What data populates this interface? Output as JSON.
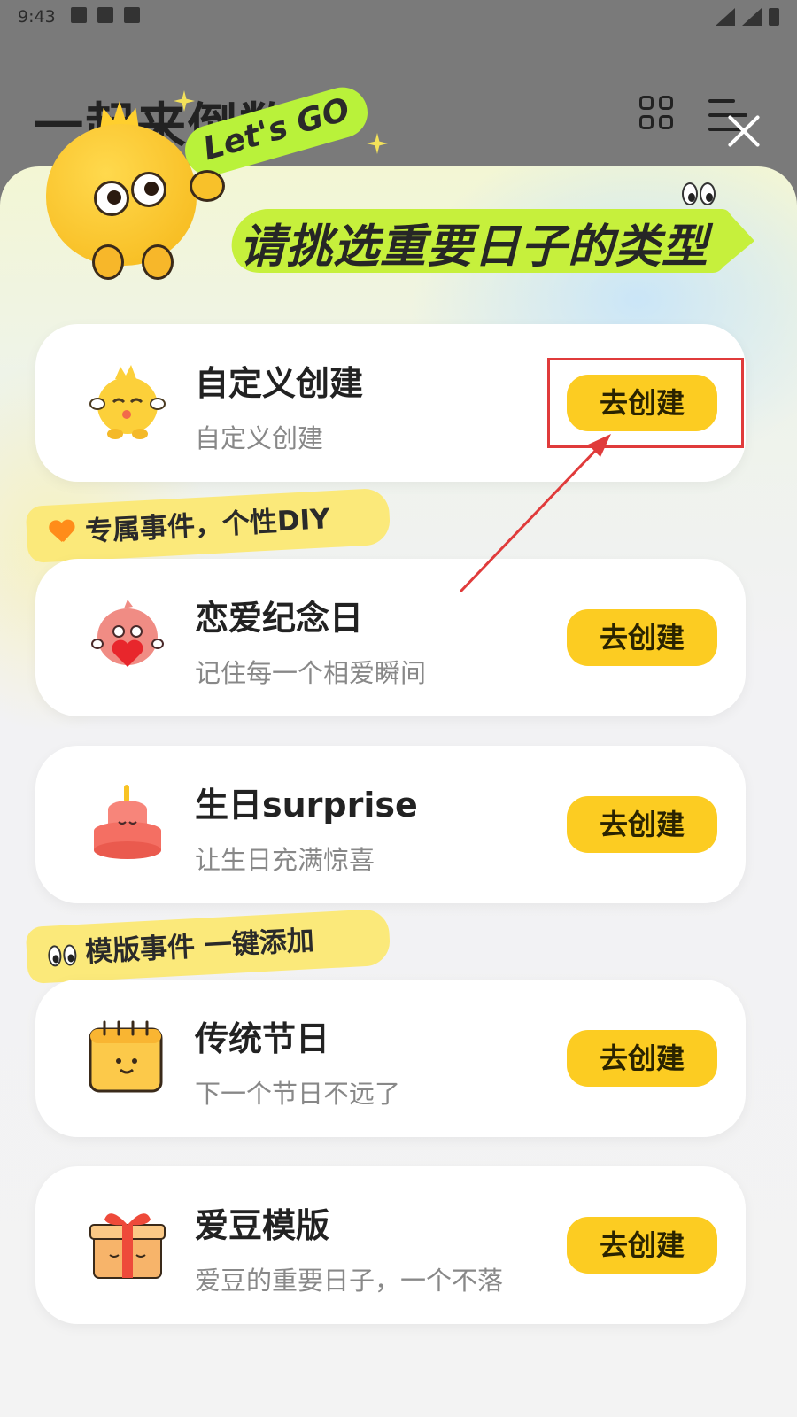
{
  "status_bar": {
    "time": "9:43"
  },
  "background_app": {
    "title": "一起来倒数"
  },
  "header": {
    "mascot_badge": "Let's GO",
    "banner_title": "请挑选重要日子的类型"
  },
  "cards": [
    {
      "title": "自定义创建",
      "subtitle": "自定义创建",
      "button": "去创建",
      "icon": "chick-mascot-icon"
    },
    {
      "title": "恋爱纪念日",
      "subtitle": "记住每一个相爱瞬间",
      "button": "去创建",
      "icon": "heart-mascot-icon"
    },
    {
      "title": "生日surprise",
      "subtitle": "让生日充满惊喜",
      "button": "去创建",
      "icon": "cake-icon"
    },
    {
      "title": "传统节日",
      "subtitle": "下一个节日不远了",
      "button": "去创建",
      "icon": "calendar-icon"
    },
    {
      "title": "爱豆模版",
      "subtitle": "爱豆的重要日子，一个不落",
      "button": "去创建",
      "icon": "gift-box-icon"
    }
  ],
  "sections": [
    {
      "label": "专属事件，个性DIY",
      "emoji": "orange-heart-icon"
    },
    {
      "label": "模版事件  一键添加",
      "emoji": "eyes-icon"
    }
  ],
  "colors": {
    "button": "#fccc22",
    "banner": "#c6f03c",
    "tag": "#fbe97a",
    "annotation": "#e03b3b"
  }
}
